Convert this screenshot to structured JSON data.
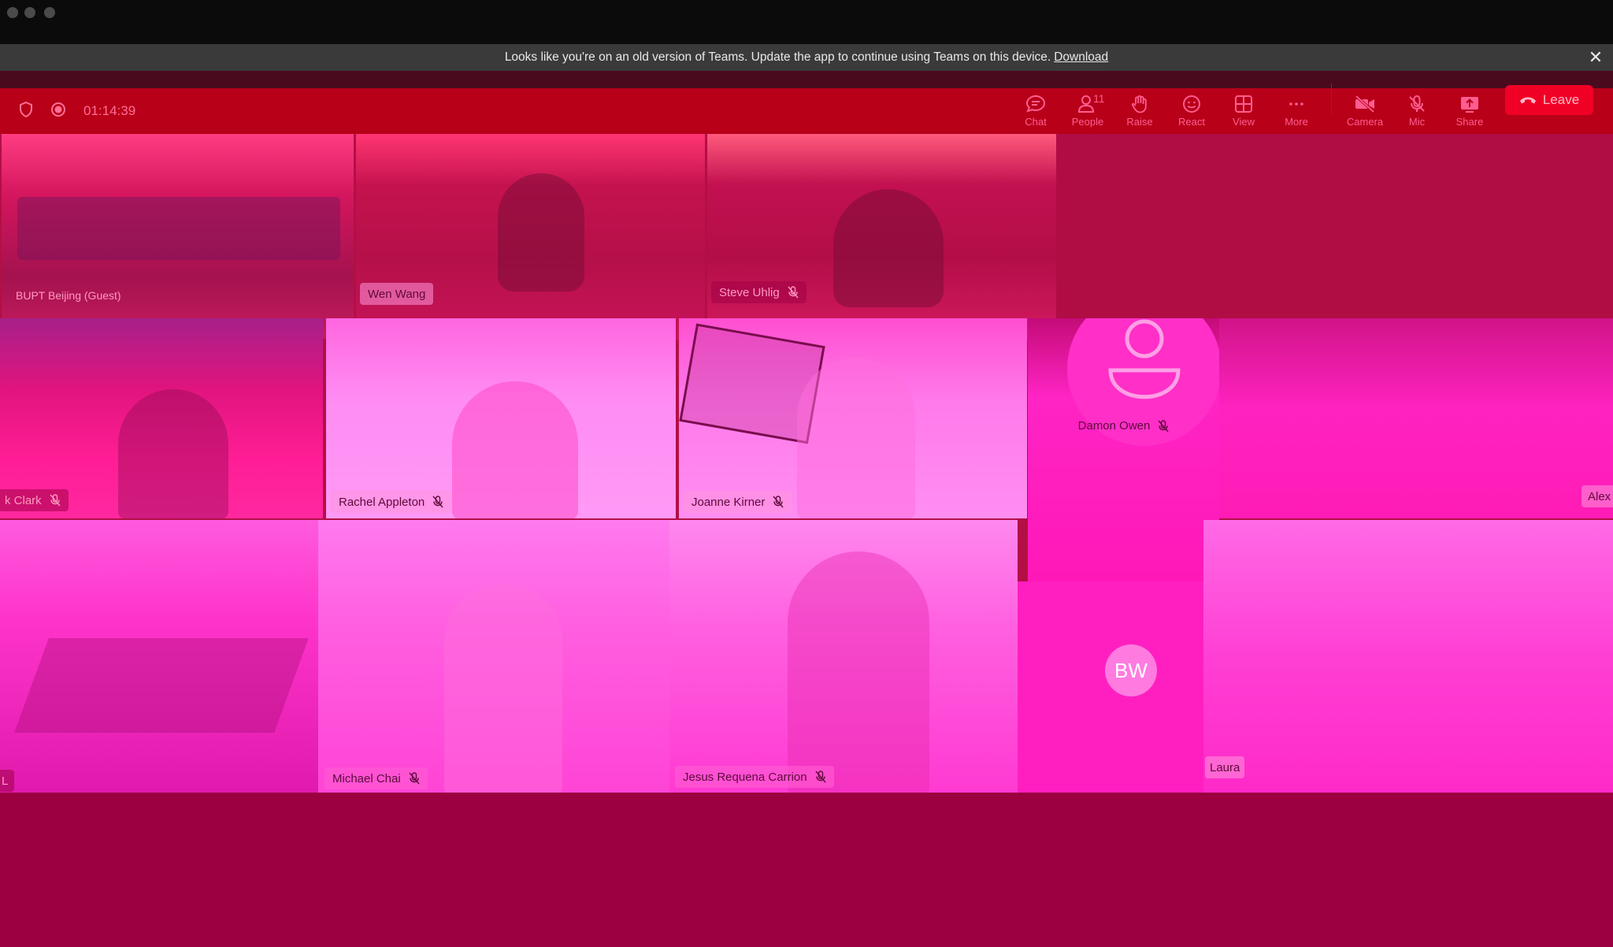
{
  "window": {
    "traffic_lights": [
      "close",
      "minimize",
      "zoom"
    ]
  },
  "banner": {
    "message": "Looks like you're on an old version of Teams. Update the app to continue using Teams on this device.",
    "link": "Download"
  },
  "toolbar": {
    "timer": "01:14:39",
    "people_count": "11",
    "buttons": [
      {
        "label": "Chat",
        "icon": "chat-icon"
      },
      {
        "label": "People",
        "icon": "people-icon"
      },
      {
        "label": "Raise",
        "icon": "hand-icon"
      },
      {
        "label": "React",
        "icon": "smiley-icon"
      },
      {
        "label": "View",
        "icon": "grid-icon"
      },
      {
        "label": "More",
        "icon": "more-icon"
      },
      {
        "label": "Camera",
        "icon": "camera-off-icon"
      },
      {
        "label": "Mic",
        "icon": "mic-off-icon"
      },
      {
        "label": "Share",
        "icon": "share-icon"
      }
    ],
    "leave_label": "Leave"
  },
  "participants": {
    "bupt": "BUPT Beijing (Guest)",
    "wen": "Wen Wang",
    "steve": "Steve Uhlig",
    "damon": "Damon Owen",
    "clark": "k Clark",
    "rachel": "Rachel Appleton",
    "joanne": "Joanne Kirner",
    "alex": "Alex",
    "michael": "Michael Chai",
    "jesus": "Jesus Requena Carrion",
    "bw_initials": "BW",
    "laura": "Laura",
    "l_cut": "L"
  },
  "colors": {
    "titlebar": "#0b0b0b",
    "banner": "#3a3a3a",
    "toolbar": "#b80019",
    "leave_button": "#f10025",
    "tile_magenta": "#ff2fc8"
  }
}
